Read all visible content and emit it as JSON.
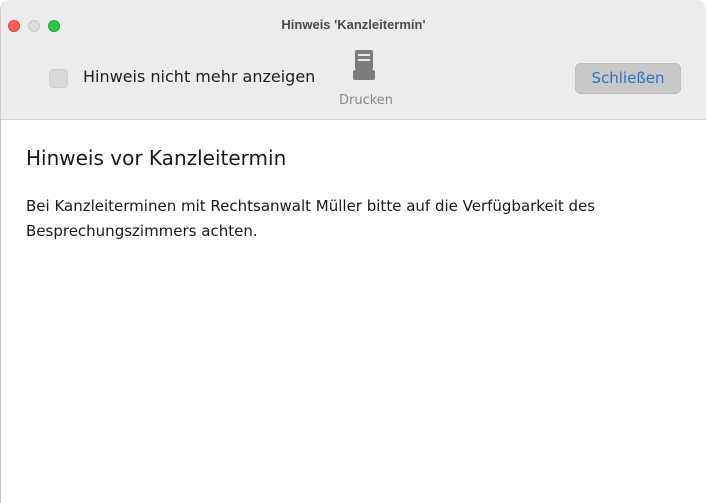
{
  "window": {
    "title": "Hinweis 'Kanzleitermin'"
  },
  "toolbar": {
    "checkbox_label": "Hinweis nicht mehr anzeigen",
    "checkbox_checked": false,
    "print_label": "Drucken",
    "close_label": "Schließen"
  },
  "content": {
    "heading": "Hinweis vor Kanzleitermin",
    "body_line1": "Bei Kanzleiterminen mit Rechtsanwalt Müller bitte auf die Verfügbarkeit des",
    "body_line2": "Besprechungszimmers achten."
  },
  "colors": {
    "close_text": "#2f6fc6",
    "traffic_close": "#ff5f57",
    "traffic_max": "#28c840"
  }
}
